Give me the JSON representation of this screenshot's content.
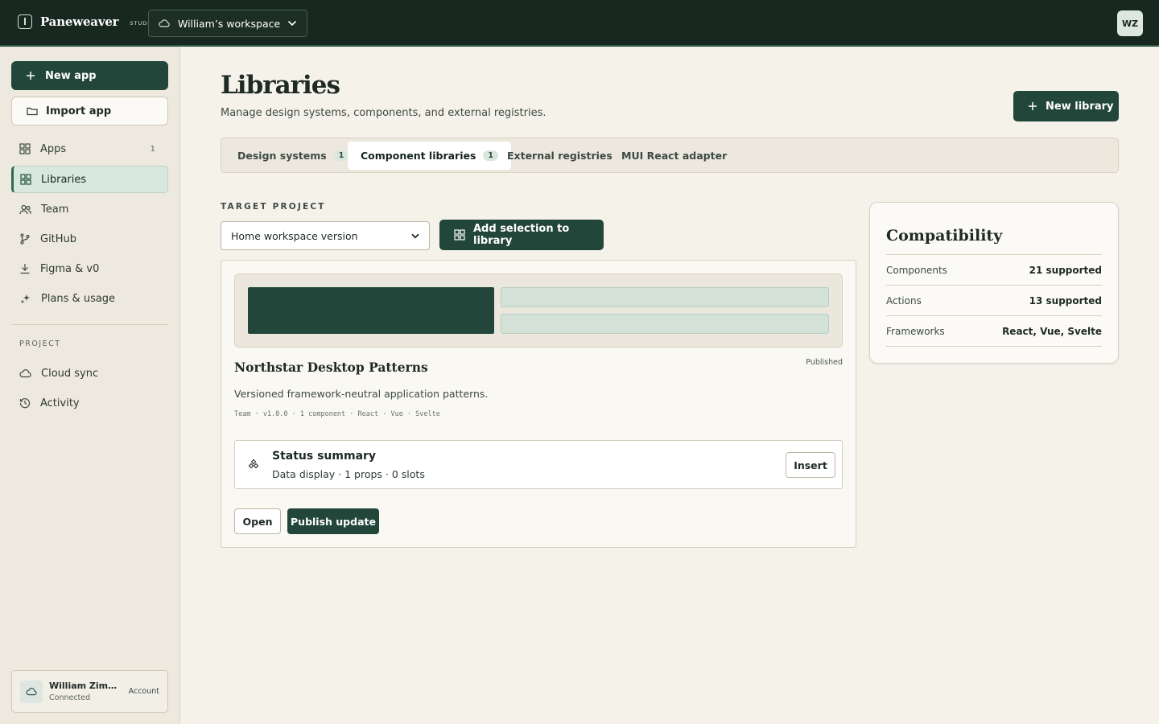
{
  "topbar": {
    "brand_name": "Paneweaver",
    "brand_sub": "STUDIO",
    "workspace": "William’s workspace",
    "avatar": "WZ"
  },
  "sidebar": {
    "new_app": "New app",
    "import_app": "Import app",
    "nav": [
      {
        "label": "Apps",
        "count": "1",
        "icon": "apps-grid-icon"
      },
      {
        "label": "Libraries",
        "count": "",
        "icon": "libraries-grid-icon",
        "active": true
      },
      {
        "label": "Team",
        "count": "",
        "icon": "team-icon"
      },
      {
        "label": "GitHub",
        "count": "",
        "icon": "github-branch-icon"
      },
      {
        "label": "Figma & v0",
        "count": "",
        "icon": "download-icon"
      },
      {
        "label": "Plans & usage",
        "count": "",
        "icon": "sparkle-icon"
      }
    ],
    "project_heading": "PROJECT",
    "project_nav": [
      {
        "label": "Cloud sync",
        "icon": "cloud-icon"
      },
      {
        "label": "Activity",
        "icon": "history-icon"
      }
    ],
    "account": {
      "name": "William Zimme...",
      "status": "Connected",
      "link": "Account"
    }
  },
  "main": {
    "title": "Libraries",
    "subtitle": "Manage design systems, components, and external registries.",
    "new_library": "New library",
    "tabs": [
      {
        "label": "Design systems",
        "badge": "1"
      },
      {
        "label": "Component libraries",
        "badge": "1",
        "active": true
      },
      {
        "label": "External registries",
        "badge": ""
      },
      {
        "label": "MUI React adapter",
        "badge": ""
      }
    ],
    "target_label": "TARGET PROJECT",
    "target_select": "Home workspace version",
    "add_selection": "Add selection to library",
    "library_card": {
      "title": "Northstar Desktop Patterns",
      "status": "Published",
      "description": "Versioned framework-neutral application patterns.",
      "meta": "Team · v1.0.0 · 1 component · React · Vue · Svelte",
      "component": {
        "name": "Status summary",
        "details": "Data display · 1 props · 0 slots",
        "insert": "Insert"
      },
      "open": "Open",
      "publish": "Publish update"
    },
    "compatibility": {
      "title": "Compatibility",
      "rows": [
        {
          "key": "Components",
          "value": "21 supported"
        },
        {
          "key": "Actions",
          "value": "13 supported"
        },
        {
          "key": "Frameworks",
          "value": "React, Vue, Svelte"
        }
      ]
    }
  },
  "colors": {
    "topbar": "#18271f",
    "accent": "#23463a",
    "background": "#f5f2ea",
    "active_nav": "#d8e8de"
  }
}
